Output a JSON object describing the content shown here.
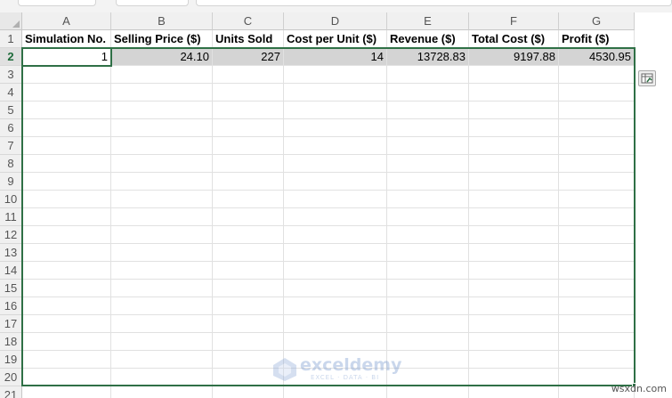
{
  "columns": [
    "A",
    "B",
    "C",
    "D",
    "E",
    "F",
    "G"
  ],
  "rows": [
    "1",
    "2",
    "3",
    "4",
    "5",
    "6",
    "7",
    "8",
    "9",
    "10",
    "11",
    "12",
    "13",
    "14",
    "15",
    "16",
    "17",
    "18",
    "19",
    "20",
    "21"
  ],
  "headers": {
    "a": "Simulation No.",
    "b": "Selling Price ($)",
    "c": "Units Sold",
    "d": "Cost per Unit ($)",
    "e": "Revenue ($)",
    "f": "Total Cost ($)",
    "g": "Profit ($)"
  },
  "data_row": {
    "a": "1",
    "b": "24.10",
    "c": "227",
    "d": "14",
    "e": "13728.83",
    "f": "9197.88",
    "g": "4530.95"
  },
  "watermark": {
    "name": "exceldemy",
    "tagline": "EXCEL · DATA · BI"
  },
  "corner_text": "wsxdn.com",
  "icons": {
    "quick_analysis": "quick-analysis-icon"
  },
  "colors": {
    "selection": "#2f7046",
    "shaded_cell": "#d4d4d4",
    "header_bg": "#f0f0f0"
  }
}
